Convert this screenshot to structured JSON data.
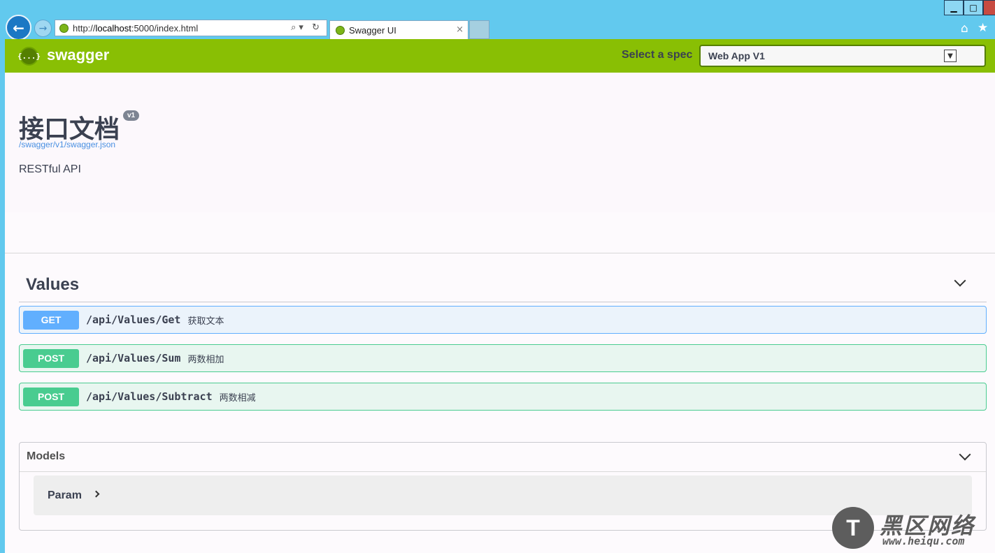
{
  "browser": {
    "back_icon": "arrow-left-icon",
    "forward_icon": "arrow-right-icon",
    "url_prefix": "http://",
    "url_host": "localhost",
    "url_rest": ":5000/index.html",
    "address_tools": "⌕▾ ↻",
    "tab_title": "Swagger UI",
    "tab_close": "×",
    "window_minimize": "▁",
    "window_maximize": "□",
    "home_icon": "⌂",
    "star_icon": "★"
  },
  "topbar": {
    "logo_mark": "{...}",
    "logo_text": "swagger",
    "spec_label": "Select a spec",
    "spec_selected": "Web App V1",
    "brand_color": "#89bf04"
  },
  "info": {
    "title": "接口文档",
    "version": "v1",
    "spec_url": "/swagger/v1/swagger.json",
    "description": "RESTful API"
  },
  "values_section": {
    "title": "Values",
    "operations": [
      {
        "method": "GET",
        "path": "/api/Values/Get",
        "summary": "获取文本"
      },
      {
        "method": "POST",
        "path": "/api/Values/Sum",
        "summary": "两数相加"
      },
      {
        "method": "POST",
        "path": "/api/Values/Subtract",
        "summary": "两数相减"
      }
    ]
  },
  "models": {
    "title": "Models",
    "items": [
      {
        "name": "Param"
      }
    ]
  },
  "watermark": {
    "logo": "T",
    "title": "黑区网络",
    "url": "www.heiqu.com"
  }
}
